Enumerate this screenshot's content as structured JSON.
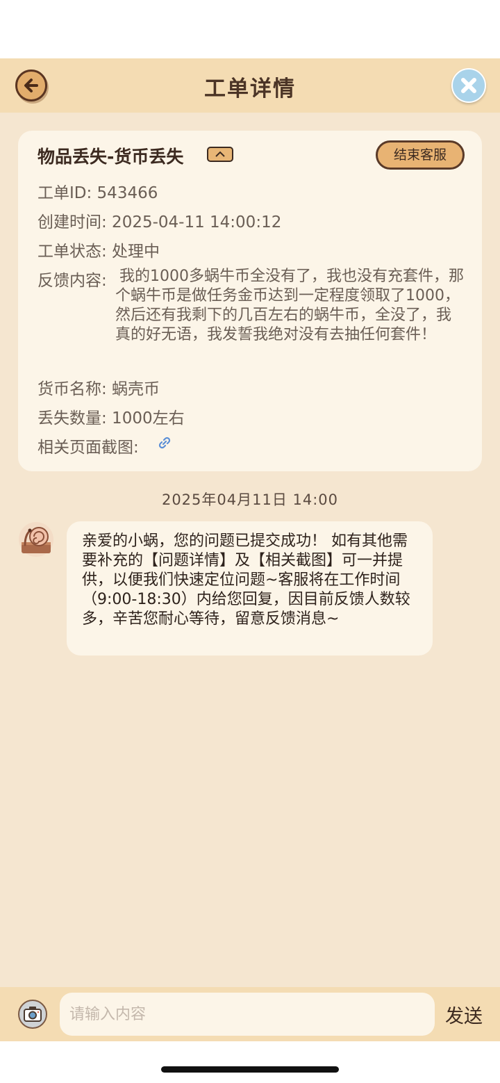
{
  "header": {
    "title": "工单详情",
    "back_icon": "arrow-left-icon",
    "close_icon": "close-icon"
  },
  "ticket": {
    "title": "物品丢失-货币丢失",
    "end_button": "结束客服",
    "id_line": "工单ID: 543466",
    "created_line": "创建时间: 2025-04-11 14:00:12",
    "status_line": "工单状态: 处理中",
    "feedback_label": "反馈内容:",
    "feedback_text": "我的1000多蜗牛币全没有了，我也没有充套件，那个蜗牛币是做任务金币达到一定程度领取了1000，然后还有我剩下的几百左右的蜗牛币，全没了，我真的好无语，我发誓我绝对没有去抽任何套件！",
    "currency_line": "货币名称: 蜗壳币",
    "amount_line": "丢失数量: 1000左右",
    "screenshot_label": "相关页面截图:"
  },
  "chat": {
    "timestamp": "2025年04月11日 14:00",
    "messages": [
      {
        "text": "亲爱的小蜗，您的问题已提交成功！ 如有其他需要补充的【问题详情】及【相关截图】可一并提供，以便我们快速定位问题~客服将在工作时间（9:00-18:30）内给您回复，因目前反馈人数较多，辛苦您耐心等待，留意反馈消息~"
      }
    ]
  },
  "composer": {
    "placeholder": "请输入内容",
    "value": "",
    "send_label": "发送"
  },
  "colors": {
    "header_bg": "#f4dcb3",
    "page_bg": "#f5e6d0",
    "card_bg": "#fcf5e8",
    "accent": "#e8b373",
    "text_dark": "#3c2a20",
    "text_muted": "#6a5e55",
    "link": "#5b8fd6"
  }
}
